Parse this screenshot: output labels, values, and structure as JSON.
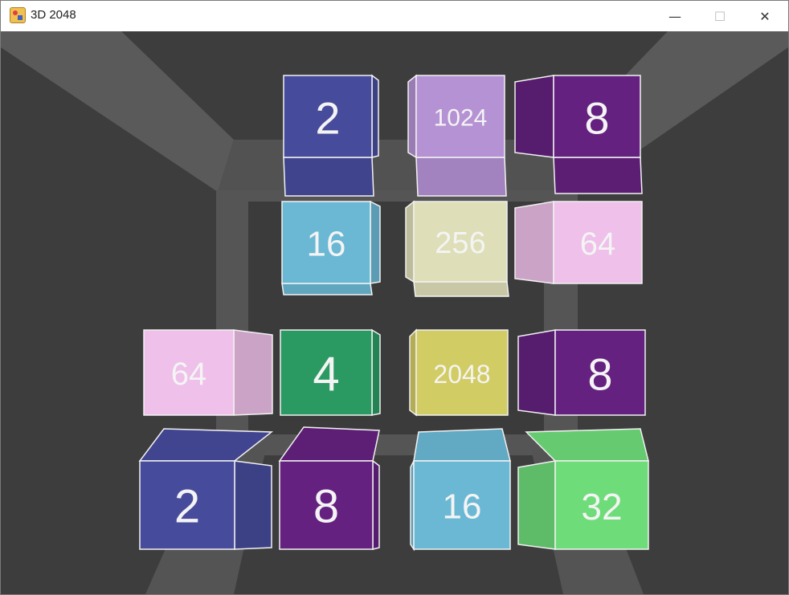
{
  "window": {
    "title": "3D 2048",
    "minimize_glyph": "—",
    "maximize_glyph": "☐",
    "close_glyph": "✕"
  },
  "colors": {
    "2": "#474b9c",
    "4": "#2a9a62",
    "8": "#652180",
    "16": "#6bb8d4",
    "32": "#6fdc7a",
    "64": "#eec0ea",
    "256": "#dedeb8",
    "1024": "#b592d4",
    "2048": "#d2cc64",
    "background": "#3d3d3d",
    "corridor": "#5f5f5f"
  },
  "tiles": [
    {
      "value": "2",
      "label": "2"
    },
    {
      "value": "1024",
      "label": "1024"
    },
    {
      "value": "8",
      "label": "8"
    },
    {
      "value": "16",
      "label": "16"
    },
    {
      "value": "256",
      "label": "256"
    },
    {
      "value": "64",
      "label": "64"
    },
    {
      "value": "64",
      "label": "64"
    },
    {
      "value": "4",
      "label": "4"
    },
    {
      "value": "2048",
      "label": "2048"
    },
    {
      "value": "8",
      "label": "8"
    },
    {
      "value": "2",
      "label": "2"
    },
    {
      "value": "8",
      "label": "8"
    },
    {
      "value": "16",
      "label": "16"
    },
    {
      "value": "32",
      "label": "32"
    }
  ]
}
